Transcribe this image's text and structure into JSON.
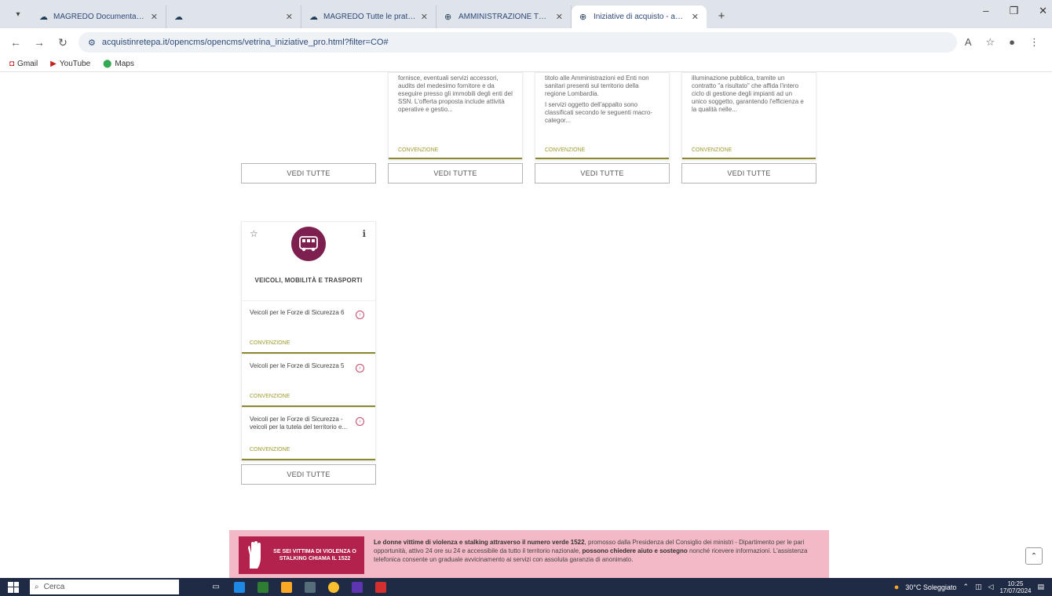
{
  "browser": {
    "tabs": [
      {
        "title": "MAGREDO Documentazio",
        "active": false
      },
      {
        "title": "",
        "active": false
      },
      {
        "title": "MAGREDO Tutte le pratiche",
        "active": false
      },
      {
        "title": "AMMINISTRAZIONE TRASPAR",
        "active": false
      },
      {
        "title": "Iniziative di acquisto - acquisti",
        "active": true
      }
    ],
    "url": "acquistinretepa.it/opencms/opencms/vetrina_iniziative_pro.html?filter=CO#",
    "bookmarks": [
      "Gmail",
      "YouTube",
      "Maps"
    ]
  },
  "top_cards": [
    {
      "desc": [
        "fornisce, eventuali servizi accessori, audits del medesimo fornitore e da eseguire presso gli immobili degli enti del SSN. L'offerta proposta include attività operative e gestio..."
      ],
      "category": "CONVENZIONE",
      "button": "VEDI TUTTE"
    },
    {
      "desc": [
        "titolo alle Amministrazioni ed Enti non sanitari presenti sul territorio della regione Lombardia.",
        "I servizi oggetto dell'appalto sono classificati secondo le seguenti macro-categor..."
      ],
      "category": "CONVENZIONE",
      "button": "VEDI TUTTE"
    },
    {
      "desc": [
        "illuminazione pubblica, tramite un contratto \"a risultato\" che affida l'intero ciclo di gestione degli impianti ad un unico soggetto, garantendo l'efficienza e la qualità nelle..."
      ],
      "category": "CONVENZIONE",
      "button": "VEDI TUTTE"
    }
  ],
  "first_col_button": "VEDI TUTTE",
  "category_card": {
    "title": "VEICOLI, MOBILITÀ E TRASPORTI",
    "items": [
      {
        "text": "Veicoli per le Forze di Sicurezza 6",
        "category": "CONVENZIONE"
      },
      {
        "text": "Veicoli per le Forze di Sicurezza 5",
        "category": "CONVENZIONE"
      },
      {
        "text": "Veicoli per le Forze di Sicurezza - veicoli per la tutela del territorio e...",
        "category": "CONVENZIONE"
      }
    ],
    "button": "VEDI TUTTE"
  },
  "banner": {
    "left_text": "SE SEI VITTIMA DI VIOLENZA O STALKING CHIAMA IL 1522",
    "bold_1": "Le donne vittime di violenza e stalking attraverso il numero verde 1522",
    "text_1": ", promosso dalla Presidenza del Consiglio dei ministri - Dipartimento per le pari opportunità, attivo 24 ore su 24 e accessibile da tutto il territorio nazionale, ",
    "bold_2": "possono chiedere aiuto e sostegno",
    "text_2": " nonché ricevere informazioni. L'assistenza telefonica consente un graduale avvicinamento ai servizi con assoluta garanzia di anonimato."
  },
  "taskbar": {
    "search": "Cerca",
    "weather": "30°C Soleggiato",
    "time": "10:25",
    "date": "17/07/2024"
  },
  "colors": {
    "category_circle": "#7d1f4f",
    "accent_bar": "#8a8a2c",
    "banner_bg": "#f4b9c6",
    "banner_box": "#b3224c"
  }
}
